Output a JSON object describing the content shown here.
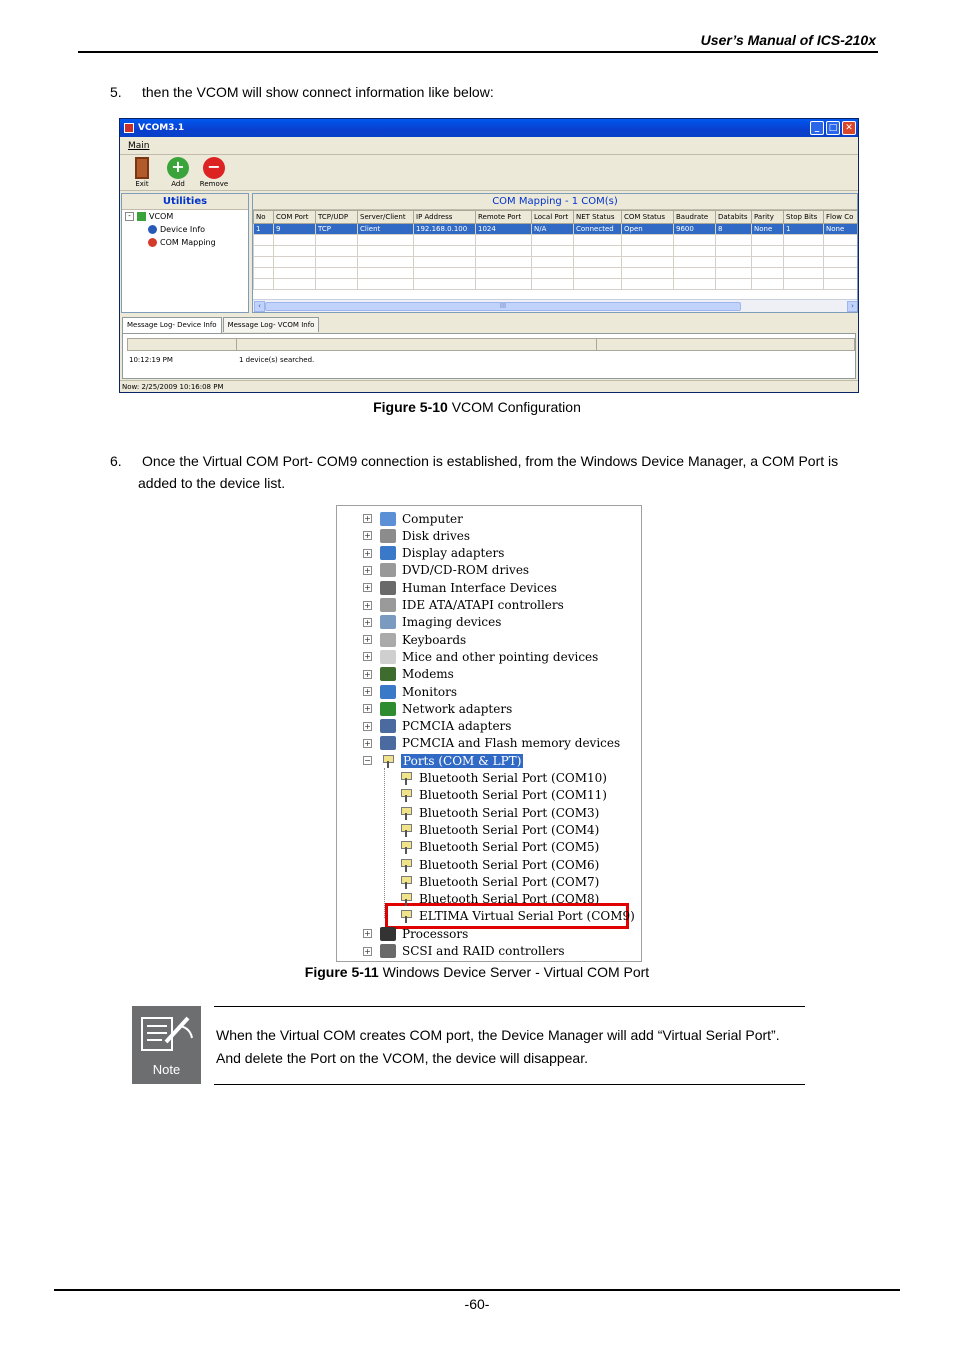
{
  "header": {
    "title": "User’s Manual of ICS-210x"
  },
  "step5": {
    "num": "5.",
    "text": "then the VCOM will show connect information like below:"
  },
  "vcom": {
    "title": "VCOM3.1",
    "menu": "Main",
    "toolbar": {
      "exit": "Exit",
      "add": "Add",
      "remove": "Remove"
    },
    "utilities": "Utilities",
    "tree": {
      "root": "VCOM",
      "device_info": "Device Info",
      "com_mapping": "COM Mapping"
    },
    "mapping_title": "COM Mapping - 1 COM(s)",
    "columns": [
      "No",
      "COM Port",
      "TCP/UDP",
      "Server/Client",
      "IP Address",
      "Remote Port",
      "Local Port",
      "NET Status",
      "COM Status",
      "Baudrate",
      "Databits",
      "Parity",
      "Stop Bits",
      "Flow Co"
    ],
    "row": [
      "1",
      "9",
      "TCP",
      "Client",
      "192.168.0.100",
      "1024",
      "N/A",
      "Connected",
      "Open",
      "9600",
      "8",
      "None",
      "1",
      "None"
    ],
    "scroll_thumb": "III",
    "tabs": [
      "Message Log- Device Info",
      "Message Log- VCOM Info"
    ],
    "log": {
      "time": "10:12:19 PM",
      "message": "1 device(s) searched."
    },
    "status": "Now: 2/25/2009 10:16:08 PM"
  },
  "fig10": {
    "label": "Figure 5-10",
    "text": " VCOM Configuration"
  },
  "step6": {
    "num": "6.",
    "line1": "Once the Virtual COM Port- COM9 connection is established, from the Windows Device Manager, a COM Port is",
    "line2": "added to the device list."
  },
  "devmgr": {
    "categories": [
      "Computer",
      "Disk drives",
      "Display adapters",
      "DVD/CD-ROM drives",
      "Human Interface Devices",
      "IDE ATA/ATAPI controllers",
      "Imaging devices",
      "Keyboards",
      "Mice and other pointing devices",
      "Modems",
      "Monitors",
      "Network adapters",
      "PCMCIA adapters",
      "PCMCIA and Flash memory devices"
    ],
    "ports_label": "Ports (COM & LPT)",
    "ports": [
      "Bluetooth Serial Port (COM10)",
      "Bluetooth Serial Port (COM11)",
      "Bluetooth Serial Port (COM3)",
      "Bluetooth Serial Port (COM4)",
      "Bluetooth Serial Port (COM5)",
      "Bluetooth Serial Port (COM6)",
      "Bluetooth Serial Port (COM7)",
      "Bluetooth Serial Port (COM8)"
    ],
    "eltima": "ELTIMA Virtual Serial Port (COM9)",
    "after": [
      "Processors",
      "SCSI and RAID controllers"
    ],
    "highlight_color": "#e00000"
  },
  "fig11": {
    "label": "Figure 5-11",
    "text": " Windows Device Server - Virtual COM Port"
  },
  "note": {
    "icon_label": "Note",
    "line1": "When the Virtual COM creates COM port, the Device Manager will add “Virtual Serial Port”.",
    "line2": "And delete the Port on the VCOM, the device will disappear."
  },
  "footer": {
    "page": "-60-"
  }
}
